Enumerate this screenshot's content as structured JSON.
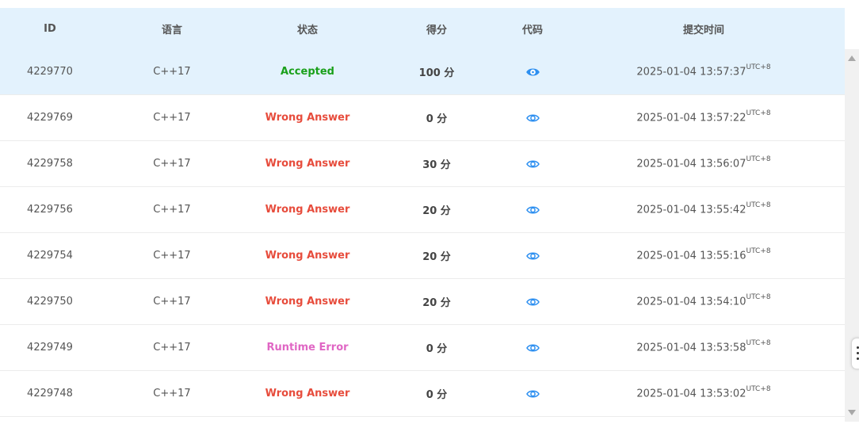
{
  "columns": {
    "id": "ID",
    "lang": "语言",
    "status": "状态",
    "score": "得分",
    "code": "代码",
    "time": "提交时间"
  },
  "rows": [
    {
      "id": "4229770",
      "lang": "C++17",
      "status": "Accepted",
      "status_type": "accepted",
      "score": "100 分",
      "time": "2025-01-04 13:57:37",
      "tz": "UTC+8"
    },
    {
      "id": "4229769",
      "lang": "C++17",
      "status": "Wrong Answer",
      "status_type": "wrong",
      "score": "0 分",
      "time": "2025-01-04 13:57:22",
      "tz": "UTC+8"
    },
    {
      "id": "4229758",
      "lang": "C++17",
      "status": "Wrong Answer",
      "status_type": "wrong",
      "score": "30 分",
      "time": "2025-01-04 13:56:07",
      "tz": "UTC+8"
    },
    {
      "id": "4229756",
      "lang": "C++17",
      "status": "Wrong Answer",
      "status_type": "wrong",
      "score": "20 分",
      "time": "2025-01-04 13:55:42",
      "tz": "UTC+8"
    },
    {
      "id": "4229754",
      "lang": "C++17",
      "status": "Wrong Answer",
      "status_type": "wrong",
      "score": "20 分",
      "time": "2025-01-04 13:55:16",
      "tz": "UTC+8"
    },
    {
      "id": "4229750",
      "lang": "C++17",
      "status": "Wrong Answer",
      "status_type": "wrong",
      "score": "20 分",
      "time": "2025-01-04 13:54:10",
      "tz": "UTC+8"
    },
    {
      "id": "4229749",
      "lang": "C++17",
      "status": "Runtime Error",
      "status_type": "runtime",
      "score": "0 分",
      "time": "2025-01-04 13:53:58",
      "tz": "UTC+8"
    },
    {
      "id": "4229748",
      "lang": "C++17",
      "status": "Wrong Answer",
      "status_type": "wrong",
      "score": "0 分",
      "time": "2025-01-04 13:53:02",
      "tz": "UTC+8"
    }
  ],
  "colors": {
    "accepted": "#1aa01a",
    "wrong": "#e74c3c",
    "runtime": "#e066c4",
    "header_bg": "#e3f2fd",
    "eye_icon": "#2d8ff0"
  },
  "icons": {
    "code": "eye-icon"
  }
}
